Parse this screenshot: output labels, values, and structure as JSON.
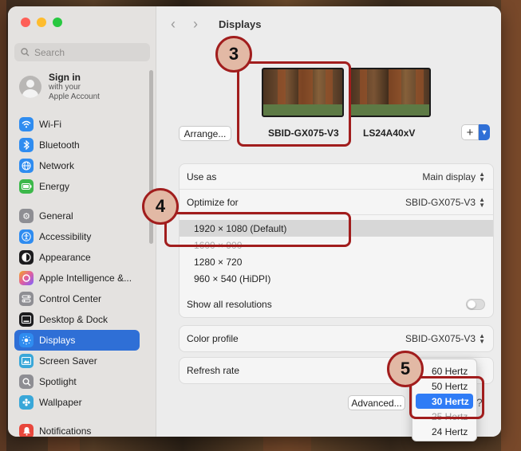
{
  "window": {
    "title": "Displays",
    "search_placeholder": "Search"
  },
  "account": {
    "title": "Sign in",
    "subtitle_line1": "with your",
    "subtitle_line2": "Apple Account"
  },
  "sidebar": {
    "items": [
      {
        "label": "Wi-Fi",
        "icon": "wifi-icon",
        "color": "#2f8cf0"
      },
      {
        "label": "Bluetooth",
        "icon": "bluetooth-icon",
        "color": "#2f8cf0"
      },
      {
        "label": "Network",
        "icon": "globe-icon",
        "color": "#2f8cf0"
      },
      {
        "label": "Energy",
        "icon": "battery-icon",
        "color": "#3cb84a"
      },
      {
        "label": "General",
        "icon": "gear-icon",
        "color": "#8e8e93"
      },
      {
        "label": "Accessibility",
        "icon": "accessibility-icon",
        "color": "#2f8cf0"
      },
      {
        "label": "Appearance",
        "icon": "appearance-icon",
        "color": "#1c1c1e"
      },
      {
        "label": "Apple Intelligence &...",
        "icon": "apple-intelligence-icon",
        "color": "#e05fa0"
      },
      {
        "label": "Control Center",
        "icon": "control-center-icon",
        "color": "#8e8e93"
      },
      {
        "label": "Desktop & Dock",
        "icon": "dock-icon",
        "color": "#1c1c1e"
      },
      {
        "label": "Displays",
        "icon": "sun-icon",
        "color": "#2f8cf0",
        "selected": true
      },
      {
        "label": "Screen Saver",
        "icon": "screen-saver-icon",
        "color": "#39a7d8"
      },
      {
        "label": "Spotlight",
        "icon": "spotlight-icon",
        "color": "#8e8e93"
      },
      {
        "label": "Wallpaper",
        "icon": "wallpaper-icon",
        "color": "#39a7d8"
      },
      {
        "label": "Notifications",
        "icon": "bell-icon",
        "color": "#e8473c"
      }
    ]
  },
  "arrangement": {
    "arrange_button": "Arrange...",
    "display1_name": "SBID-GX075-V3",
    "display2_name": "LS24A40xV",
    "add_button": "+"
  },
  "settings": {
    "use_as_label": "Use as",
    "use_as_value": "Main display",
    "optimize_label": "Optimize for",
    "optimize_value": "SBID-GX075-V3",
    "resolutions": [
      {
        "label": "1920 × 1080 (Default)",
        "selected": true
      },
      {
        "label": "1600 × 900",
        "faded": true
      },
      {
        "label": "1280 × 720"
      },
      {
        "label": "960 × 540 (HiDPI)"
      }
    ],
    "show_all_label": "Show all resolutions",
    "show_all_on": false,
    "color_profile_label": "Color profile",
    "color_profile_value": "SBID-GX075-V3",
    "refresh_label": "Refresh rate",
    "advanced_button": "Advanced...",
    "help": "?"
  },
  "refresh_menu": {
    "options": [
      {
        "label": "60 Hertz"
      },
      {
        "label": "50 Hertz"
      },
      {
        "label": "30 Hertz",
        "selected": true
      },
      {
        "label": "25 Hertz",
        "faded": true
      },
      {
        "label": "24 Hertz"
      }
    ]
  },
  "annotations": {
    "step3": "3",
    "step4": "4",
    "step5": "5",
    "color": "#a11d1d"
  }
}
